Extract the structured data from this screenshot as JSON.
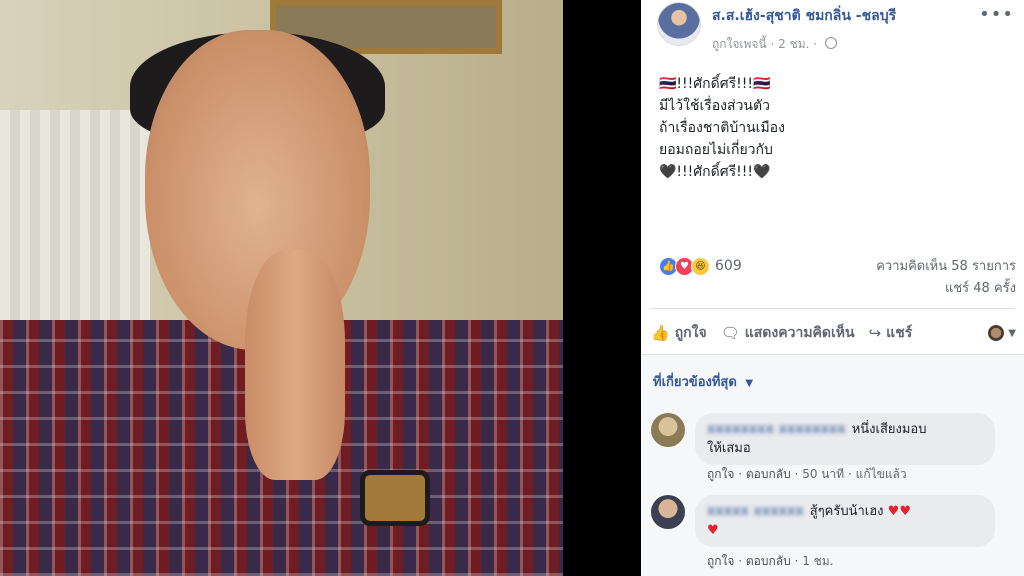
{
  "post": {
    "author_name": "ส.ส.เฮ้ง-สุชาติ ชมกลิ่น -ชลบุรี",
    "like_page_label": "ถูกใจเพจนี้",
    "time": "2 ชม.",
    "more_icon": "more-horizontal-icon",
    "text_lines": [
      "🇹🇭!!!ศักดิ์ศรี!!!🇹🇭",
      "มีไว้ใช้เรื่องส่วนตัว",
      "ถ้าเรื่องชาติบ้านเมือง",
      "ยอมถอยไม่เกี่ยวกับ",
      "🖤!!!ศักดิ์ศรี!!!🖤"
    ]
  },
  "reactions": {
    "count": "609",
    "comments": "ความคิดเห็น 58 รายการ",
    "shares": "แชร์ 48 ครั้ง"
  },
  "actions": {
    "like": "ถูกใจ",
    "comment": "แสดงความคิดเห็น",
    "share": "แชร์"
  },
  "comments_filter": "ที่เกี่ยวข้องที่สุด",
  "comments": [
    {
      "name": "xxxxxxxx xxxxxxxx",
      "text_line1": "หนึ่งเสียงมอบ",
      "text_line2": "ให้เสมอ",
      "like": "ถูกใจ",
      "reply": "ตอบกลับ",
      "time": "50 นาที",
      "edited": "แก้ไขแล้ว"
    },
    {
      "name": "xxxxx xxxxxx",
      "text_line1": "สู้ๆครับน้าเฮง",
      "hearts1": "♥♥",
      "hearts2": "♥",
      "like": "ถูกใจ",
      "reply": "ตอบกลับ",
      "time": "1 ชม."
    }
  ],
  "colors": {
    "link_blue": "#365899",
    "muted": "#606770",
    "comment_bubble": "#e9ebee"
  }
}
